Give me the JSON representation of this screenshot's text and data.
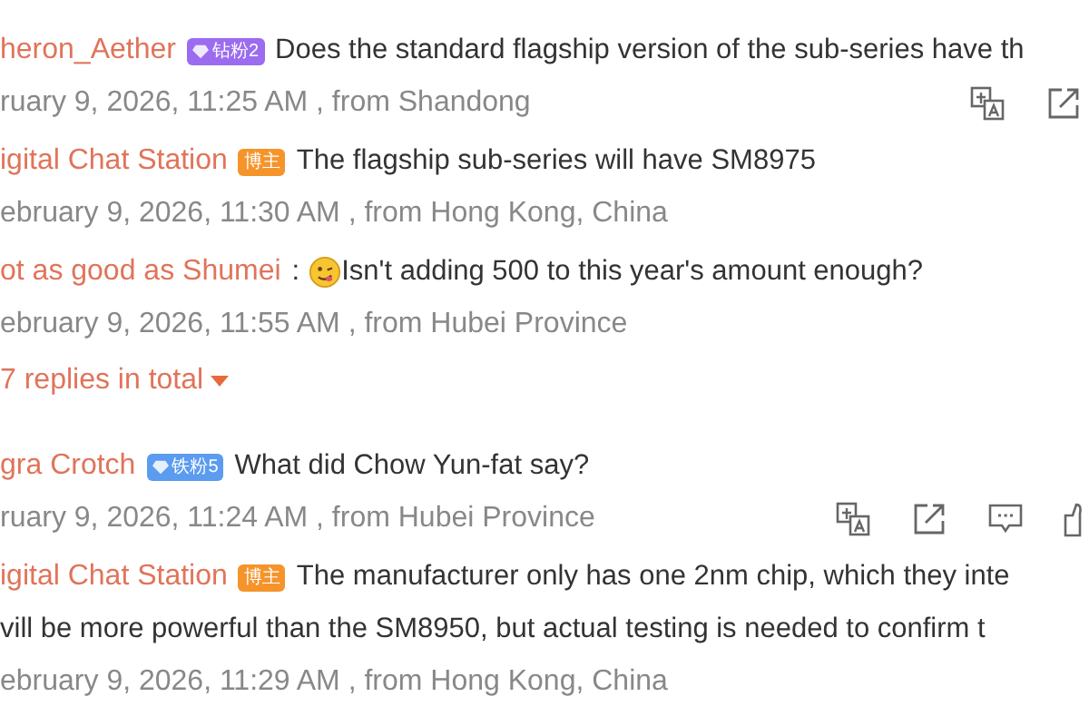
{
  "items": [
    {
      "kind": "comment",
      "name": "heron_Aether",
      "badge": {
        "kind": "fan",
        "label": "钻粉2",
        "color": "#9b6cf0"
      },
      "lines": [
        "Does the standard flagship version of the sub-series have th"
      ],
      "meta": "ruary 9, 2026, 11:25 AM , from Shandong",
      "actions": [
        {
          "kind": "translate"
        },
        {
          "kind": "share"
        }
      ]
    },
    {
      "kind": "comment",
      "name": "igital Chat Station",
      "badge": {
        "kind": "blogger",
        "label": "博主",
        "color": "#f5942b"
      },
      "lines": [
        "The flagship sub-series will have SM8975"
      ],
      "meta": "ebruary 9, 2026, 11:30 AM , from Hong Kong, China"
    },
    {
      "kind": "comment",
      "name": "ot as good as Shumei",
      "separator": ":",
      "emoji": true,
      "lines": [
        "Isn't adding 500 to this year's amount enough?"
      ],
      "meta": "ebruary 9, 2026, 11:55 AM , from Hubei Province"
    },
    {
      "kind": "replies",
      "label": "7 replies in total"
    },
    {
      "kind": "comment",
      "name": "gra Crotch",
      "badge": {
        "kind": "fan",
        "label": "铁粉5",
        "color": "#5b9cf0"
      },
      "lines": [
        "What did Chow Yun-fat say?"
      ],
      "meta": "ruary 9, 2026, 11:24 AM , from Hubei Province",
      "actions": [
        {
          "kind": "translate"
        },
        {
          "kind": "share"
        },
        {
          "kind": "comment"
        },
        {
          "kind": "like"
        }
      ]
    },
    {
      "kind": "comment",
      "name": "igital Chat Station",
      "badge": {
        "kind": "blogger",
        "label": "博主",
        "color": "#f5942b"
      },
      "lines": [
        "The manufacturer only has one 2nm chip, which they inte",
        "vill be more powerful than the SM8950, but actual testing is needed to confirm t"
      ],
      "meta": "ebruary 9, 2026, 11:29 AM , from Hong Kong, China"
    }
  ]
}
